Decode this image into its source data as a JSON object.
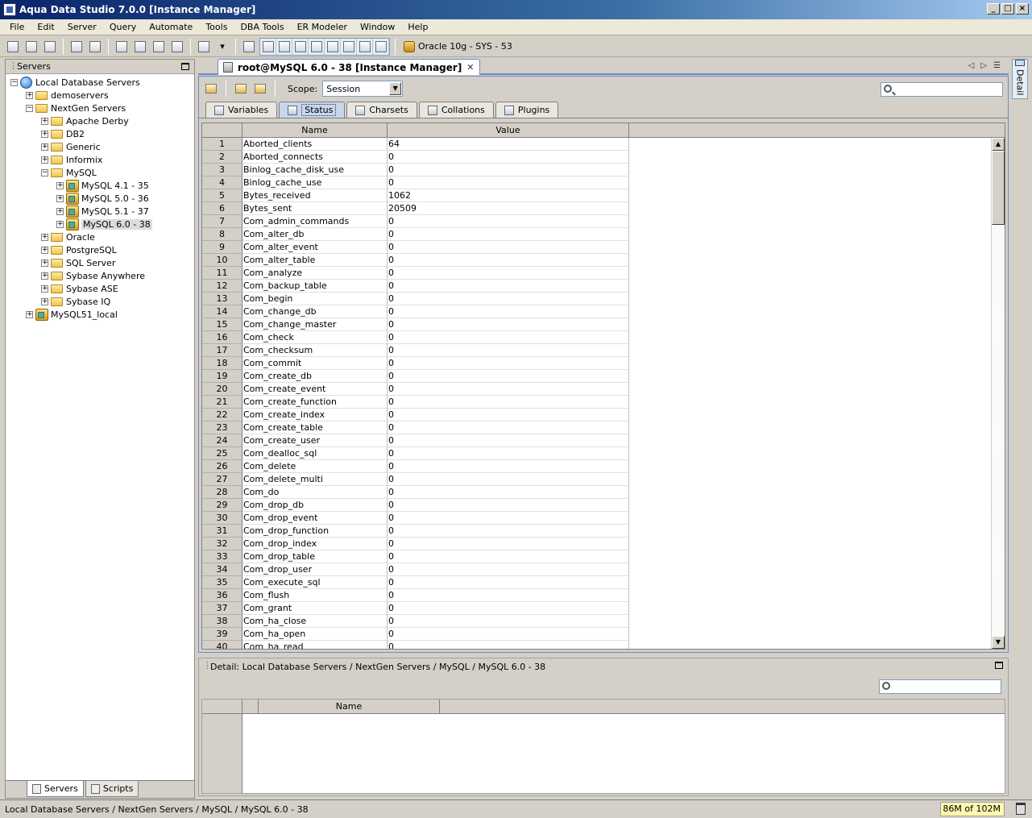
{
  "window": {
    "title": "Aqua Data Studio 7.0.0 [Instance Manager]"
  },
  "menu": [
    "File",
    "Edit",
    "Server",
    "Query",
    "Automate",
    "Tools",
    "DBA Tools",
    "ER Modeler",
    "Window",
    "Help"
  ],
  "toolbar": {
    "connection_label": "Oracle 10g - SYS - 53"
  },
  "servers_panel": {
    "title": "Servers",
    "tree": [
      {
        "label": "Local Database Servers",
        "depth": 0,
        "expander": "−",
        "icon": "globe-icon"
      },
      {
        "label": "demoservers",
        "depth": 1,
        "expander": "+",
        "icon": "folder-icon"
      },
      {
        "label": "NextGen Servers",
        "depth": 1,
        "expander": "−",
        "icon": "folder-icon"
      },
      {
        "label": "Apache Derby",
        "depth": 2,
        "expander": "+",
        "icon": "folder-icon"
      },
      {
        "label": "DB2",
        "depth": 2,
        "expander": "+",
        "icon": "folder-icon"
      },
      {
        "label": "Generic",
        "depth": 2,
        "expander": "+",
        "icon": "folder-icon"
      },
      {
        "label": "Informix",
        "depth": 2,
        "expander": "+",
        "icon": "folder-icon"
      },
      {
        "label": "MySQL",
        "depth": 2,
        "expander": "−",
        "icon": "folder-icon"
      },
      {
        "label": "MySQL 4.1 - 35",
        "depth": 3,
        "expander": "+",
        "icon": "server-icon"
      },
      {
        "label": "MySQL 5.0 - 36",
        "depth": 3,
        "expander": "+",
        "icon": "server-icon"
      },
      {
        "label": "MySQL 5.1 - 37",
        "depth": 3,
        "expander": "+",
        "icon": "server-icon"
      },
      {
        "label": "MySQL 6.0 - 38",
        "depth": 3,
        "expander": "+",
        "icon": "server-icon",
        "selected": true
      },
      {
        "label": "Oracle",
        "depth": 2,
        "expander": "+",
        "icon": "folder-icon"
      },
      {
        "label": "PostgreSQL",
        "depth": 2,
        "expander": "+",
        "icon": "folder-icon"
      },
      {
        "label": "SQL Server",
        "depth": 2,
        "expander": "+",
        "icon": "folder-icon"
      },
      {
        "label": "Sybase Anywhere",
        "depth": 2,
        "expander": "+",
        "icon": "folder-icon"
      },
      {
        "label": "Sybase ASE",
        "depth": 2,
        "expander": "+",
        "icon": "folder-icon"
      },
      {
        "label": "Sybase IQ",
        "depth": 2,
        "expander": "+",
        "icon": "folder-icon"
      },
      {
        "label": "MySQL51_local",
        "depth": 1,
        "expander": "+",
        "icon": "server-icon"
      }
    ],
    "bottom_tabs": [
      "Servers",
      "Scripts"
    ]
  },
  "detail_strip": {
    "label": "Detail"
  },
  "editor": {
    "tab_title": "root@MySQL 6.0 - 38 [Instance Manager]",
    "tab_close": "✕",
    "scope_label": "Scope:",
    "scope_value": "Session",
    "sub_tabs": [
      "Variables",
      "Status",
      "Charsets",
      "Collations",
      "Plugins"
    ],
    "active_sub_tab": "Status",
    "columns": [
      "Name",
      "Value"
    ],
    "rows": [
      [
        "1",
        "Aborted_clients",
        "64"
      ],
      [
        "2",
        "Aborted_connects",
        "0"
      ],
      [
        "3",
        "Binlog_cache_disk_use",
        "0"
      ],
      [
        "4",
        "Binlog_cache_use",
        "0"
      ],
      [
        "5",
        "Bytes_received",
        "1062"
      ],
      [
        "6",
        "Bytes_sent",
        "20509"
      ],
      [
        "7",
        "Com_admin_commands",
        "0"
      ],
      [
        "8",
        "Com_alter_db",
        "0"
      ],
      [
        "9",
        "Com_alter_event",
        "0"
      ],
      [
        "10",
        "Com_alter_table",
        "0"
      ],
      [
        "11",
        "Com_analyze",
        "0"
      ],
      [
        "12",
        "Com_backup_table",
        "0"
      ],
      [
        "13",
        "Com_begin",
        "0"
      ],
      [
        "14",
        "Com_change_db",
        "0"
      ],
      [
        "15",
        "Com_change_master",
        "0"
      ],
      [
        "16",
        "Com_check",
        "0"
      ],
      [
        "17",
        "Com_checksum",
        "0"
      ],
      [
        "18",
        "Com_commit",
        "0"
      ],
      [
        "19",
        "Com_create_db",
        "0"
      ],
      [
        "20",
        "Com_create_event",
        "0"
      ],
      [
        "21",
        "Com_create_function",
        "0"
      ],
      [
        "22",
        "Com_create_index",
        "0"
      ],
      [
        "23",
        "Com_create_table",
        "0"
      ],
      [
        "24",
        "Com_create_user",
        "0"
      ],
      [
        "25",
        "Com_dealloc_sql",
        "0"
      ],
      [
        "26",
        "Com_delete",
        "0"
      ],
      [
        "27",
        "Com_delete_multi",
        "0"
      ],
      [
        "28",
        "Com_do",
        "0"
      ],
      [
        "29",
        "Com_drop_db",
        "0"
      ],
      [
        "30",
        "Com_drop_event",
        "0"
      ],
      [
        "31",
        "Com_drop_function",
        "0"
      ],
      [
        "32",
        "Com_drop_index",
        "0"
      ],
      [
        "33",
        "Com_drop_table",
        "0"
      ],
      [
        "34",
        "Com_drop_user",
        "0"
      ],
      [
        "35",
        "Com_execute_sql",
        "0"
      ],
      [
        "36",
        "Com_flush",
        "0"
      ],
      [
        "37",
        "Com_grant",
        "0"
      ],
      [
        "38",
        "Com_ha_close",
        "0"
      ],
      [
        "39",
        "Com_ha_open",
        "0"
      ],
      [
        "40",
        "Com_ha_read",
        "0"
      ]
    ]
  },
  "detail_panel": {
    "title": "Detail: Local Database Servers / NextGen Servers / MySQL / MySQL 6.0 - 38",
    "columns": [
      "Name"
    ]
  },
  "statusbar": {
    "path": "Local Database Servers / NextGen Servers / MySQL / MySQL 6.0 - 38",
    "memory": "86M of 102M"
  }
}
